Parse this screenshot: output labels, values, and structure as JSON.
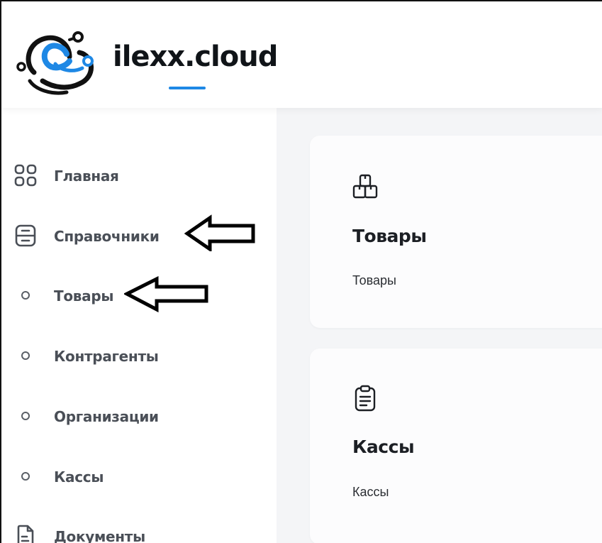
{
  "brand": {
    "name": "ilexx.cloud",
    "accent_color": "#1e88e5"
  },
  "sidebar": {
    "items": [
      {
        "label": "Главная",
        "icon": "grid-icon",
        "level": 0
      },
      {
        "label": "Справочники",
        "icon": "directory-icon",
        "level": 0
      },
      {
        "label": "Товары",
        "icon": "bullet-icon",
        "level": 1
      },
      {
        "label": "Контрагенты",
        "icon": "bullet-icon",
        "level": 1
      },
      {
        "label": "Организации",
        "icon": "bullet-icon",
        "level": 1
      },
      {
        "label": "Кассы",
        "icon": "bullet-icon",
        "level": 1
      },
      {
        "label": "Документы",
        "icon": "document-icon",
        "level": 0
      }
    ]
  },
  "main": {
    "cards": [
      {
        "icon": "boxes-icon",
        "title": "Товары",
        "subtitle": "Товары"
      },
      {
        "icon": "clipboard-icon",
        "title": "Кассы",
        "subtitle": "Кассы"
      }
    ]
  },
  "annotations": {
    "arrows": [
      "left-arrow",
      "left-arrow"
    ]
  }
}
